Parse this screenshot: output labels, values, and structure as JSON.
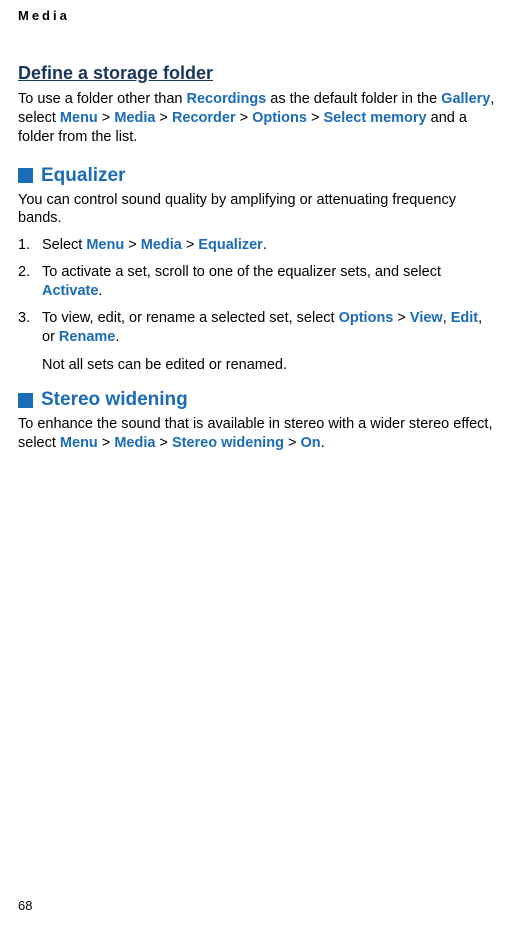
{
  "running_header": "Media",
  "storage_folder": {
    "title": "Define a storage folder",
    "para_prefix": "To use a folder other than ",
    "link_recordings": "Recordings",
    "para_mid1": " as the default folder in the ",
    "link_gallery": "Gallery",
    "para_mid2": ", select ",
    "link_menu": "Menu",
    "link_media": "Media",
    "link_recorder": "Recorder",
    "link_options": "Options",
    "link_select_memory": "Select memory",
    "para_suffix": " and a folder from the list."
  },
  "equalizer": {
    "title": "Equalizer",
    "intro": "You can control sound quality by amplifying or attenuating frequency bands.",
    "step1": {
      "num": "1.",
      "prefix": "Select ",
      "link_menu": "Menu",
      "link_media": "Media",
      "link_equalizer": "Equalizer",
      "suffix": "."
    },
    "step2": {
      "num": "2.",
      "prefix": "To activate a set, scroll to one of the equalizer sets, and select ",
      "link_activate": "Activate",
      "suffix": "."
    },
    "step3": {
      "num": "3.",
      "prefix": "To view, edit, or rename a selected set, select ",
      "link_options": "Options",
      "link_view": "View",
      "link_edit": "Edit",
      "or_text": ", or ",
      "link_rename": "Rename",
      "suffix": "."
    },
    "note": "Not all sets can be edited or renamed."
  },
  "stereo": {
    "title": "Stereo widening",
    "prefix": "To enhance the sound that is available in stereo with a wider stereo effect, select ",
    "link_menu": "Menu",
    "link_media": "Media",
    "link_stereo_widening": "Stereo widening",
    "link_on": "On",
    "suffix": "."
  },
  "page_number": "68",
  "gt": " > "
}
